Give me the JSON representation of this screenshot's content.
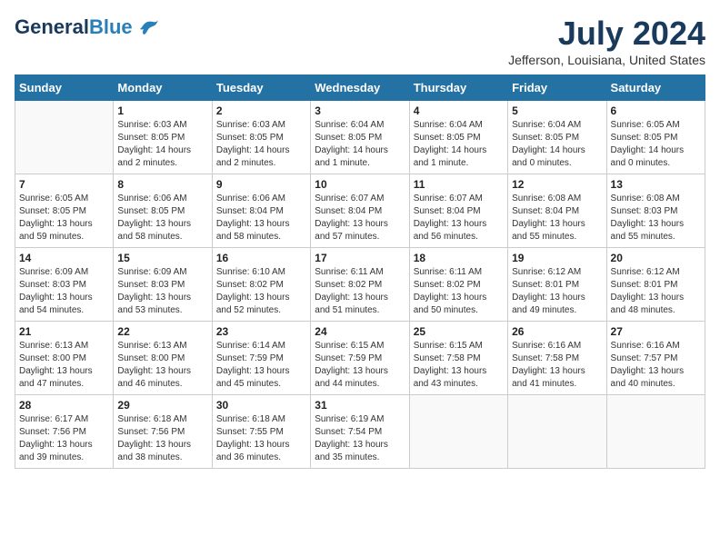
{
  "header": {
    "logo_general": "General",
    "logo_blue": "Blue",
    "month_title": "July 2024",
    "subtitle": "Jefferson, Louisiana, United States"
  },
  "weekdays": [
    "Sunday",
    "Monday",
    "Tuesday",
    "Wednesday",
    "Thursday",
    "Friday",
    "Saturday"
  ],
  "weeks": [
    [
      {
        "day": "",
        "info": ""
      },
      {
        "day": "1",
        "info": "Sunrise: 6:03 AM\nSunset: 8:05 PM\nDaylight: 14 hours\nand 2 minutes."
      },
      {
        "day": "2",
        "info": "Sunrise: 6:03 AM\nSunset: 8:05 PM\nDaylight: 14 hours\nand 2 minutes."
      },
      {
        "day": "3",
        "info": "Sunrise: 6:04 AM\nSunset: 8:05 PM\nDaylight: 14 hours\nand 1 minute."
      },
      {
        "day": "4",
        "info": "Sunrise: 6:04 AM\nSunset: 8:05 PM\nDaylight: 14 hours\nand 1 minute."
      },
      {
        "day": "5",
        "info": "Sunrise: 6:04 AM\nSunset: 8:05 PM\nDaylight: 14 hours\nand 0 minutes."
      },
      {
        "day": "6",
        "info": "Sunrise: 6:05 AM\nSunset: 8:05 PM\nDaylight: 14 hours\nand 0 minutes."
      }
    ],
    [
      {
        "day": "7",
        "info": "Sunrise: 6:05 AM\nSunset: 8:05 PM\nDaylight: 13 hours\nand 59 minutes."
      },
      {
        "day": "8",
        "info": "Sunrise: 6:06 AM\nSunset: 8:05 PM\nDaylight: 13 hours\nand 58 minutes."
      },
      {
        "day": "9",
        "info": "Sunrise: 6:06 AM\nSunset: 8:04 PM\nDaylight: 13 hours\nand 58 minutes."
      },
      {
        "day": "10",
        "info": "Sunrise: 6:07 AM\nSunset: 8:04 PM\nDaylight: 13 hours\nand 57 minutes."
      },
      {
        "day": "11",
        "info": "Sunrise: 6:07 AM\nSunset: 8:04 PM\nDaylight: 13 hours\nand 56 minutes."
      },
      {
        "day": "12",
        "info": "Sunrise: 6:08 AM\nSunset: 8:04 PM\nDaylight: 13 hours\nand 55 minutes."
      },
      {
        "day": "13",
        "info": "Sunrise: 6:08 AM\nSunset: 8:03 PM\nDaylight: 13 hours\nand 55 minutes."
      }
    ],
    [
      {
        "day": "14",
        "info": "Sunrise: 6:09 AM\nSunset: 8:03 PM\nDaylight: 13 hours\nand 54 minutes."
      },
      {
        "day": "15",
        "info": "Sunrise: 6:09 AM\nSunset: 8:03 PM\nDaylight: 13 hours\nand 53 minutes."
      },
      {
        "day": "16",
        "info": "Sunrise: 6:10 AM\nSunset: 8:02 PM\nDaylight: 13 hours\nand 52 minutes."
      },
      {
        "day": "17",
        "info": "Sunrise: 6:11 AM\nSunset: 8:02 PM\nDaylight: 13 hours\nand 51 minutes."
      },
      {
        "day": "18",
        "info": "Sunrise: 6:11 AM\nSunset: 8:02 PM\nDaylight: 13 hours\nand 50 minutes."
      },
      {
        "day": "19",
        "info": "Sunrise: 6:12 AM\nSunset: 8:01 PM\nDaylight: 13 hours\nand 49 minutes."
      },
      {
        "day": "20",
        "info": "Sunrise: 6:12 AM\nSunset: 8:01 PM\nDaylight: 13 hours\nand 48 minutes."
      }
    ],
    [
      {
        "day": "21",
        "info": "Sunrise: 6:13 AM\nSunset: 8:00 PM\nDaylight: 13 hours\nand 47 minutes."
      },
      {
        "day": "22",
        "info": "Sunrise: 6:13 AM\nSunset: 8:00 PM\nDaylight: 13 hours\nand 46 minutes."
      },
      {
        "day": "23",
        "info": "Sunrise: 6:14 AM\nSunset: 7:59 PM\nDaylight: 13 hours\nand 45 minutes."
      },
      {
        "day": "24",
        "info": "Sunrise: 6:15 AM\nSunset: 7:59 PM\nDaylight: 13 hours\nand 44 minutes."
      },
      {
        "day": "25",
        "info": "Sunrise: 6:15 AM\nSunset: 7:58 PM\nDaylight: 13 hours\nand 43 minutes."
      },
      {
        "day": "26",
        "info": "Sunrise: 6:16 AM\nSunset: 7:58 PM\nDaylight: 13 hours\nand 41 minutes."
      },
      {
        "day": "27",
        "info": "Sunrise: 6:16 AM\nSunset: 7:57 PM\nDaylight: 13 hours\nand 40 minutes."
      }
    ],
    [
      {
        "day": "28",
        "info": "Sunrise: 6:17 AM\nSunset: 7:56 PM\nDaylight: 13 hours\nand 39 minutes."
      },
      {
        "day": "29",
        "info": "Sunrise: 6:18 AM\nSunset: 7:56 PM\nDaylight: 13 hours\nand 38 minutes."
      },
      {
        "day": "30",
        "info": "Sunrise: 6:18 AM\nSunset: 7:55 PM\nDaylight: 13 hours\nand 36 minutes."
      },
      {
        "day": "31",
        "info": "Sunrise: 6:19 AM\nSunset: 7:54 PM\nDaylight: 13 hours\nand 35 minutes."
      },
      {
        "day": "",
        "info": ""
      },
      {
        "day": "",
        "info": ""
      },
      {
        "day": "",
        "info": ""
      }
    ]
  ]
}
